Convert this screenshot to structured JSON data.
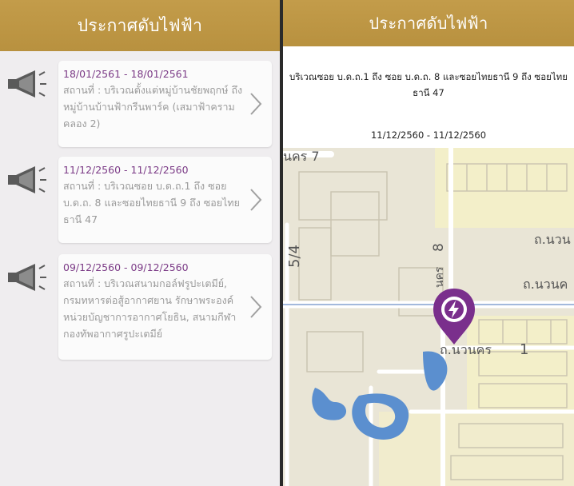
{
  "left_panel": {
    "title": "ประกาศดับไฟฟ้า",
    "notices": [
      {
        "date": "18/01/2561 - 18/01/2561",
        "place": "สถานที่ : บริเวณตั้งแต่หมู่บ้านชัยพฤกษ์ ถึง หมู่บ้านบ้านฟ้ากรีนพาร์ค (เสมาฟ้าครามคลอง 2)"
      },
      {
        "date": "11/12/2560 - 11/12/2560",
        "place": "สถานที่ : บริเวณซอย บ.ด.ถ.1 ถึง ซอย บ.ด.ถ. 8 และซอยไทยธานี 9 ถึง ซอยไทยธานี 47"
      },
      {
        "date": "09/12/2560 - 09/12/2560",
        "place": "สถานที่ : บริเวณสนามกอล์ฟรูปะเตมีย์, กรมทหารต่อสู้อากาศยาน รักษาพระองค์หน่วยบัญชาการอากาศโยธิน, สนามกีฬากองทัพอากาศรูปะเตมีย์"
      }
    ]
  },
  "right_panel": {
    "title": "ประกาศดับไฟฟ้า",
    "detail_place": "บริเวณซอย บ.ด.ถ.1 ถึง ซอย บ.ด.ถ. 8 และซอยไทยธานี 9 ถึง ซอยไทยธานี 47",
    "detail_date": "11/12/2560 - 11/12/2560",
    "map_labels": {
      "street_top": "นคร 7",
      "street_left": "5/4",
      "street_8_num": "8",
      "street_8_text": "นคร",
      "road_right_1": "ถ.นวน",
      "road_right_2": "ถ.นวนค",
      "road_bottom": "ถ.นวนคร",
      "road_bottom_num": "1"
    },
    "pin_icon": "lightning-bolt-icon"
  },
  "colors": {
    "header": "#bf9744",
    "date_text": "#7b3a86",
    "pin": "#7a2f8c",
    "water": "#5b8fcf"
  }
}
